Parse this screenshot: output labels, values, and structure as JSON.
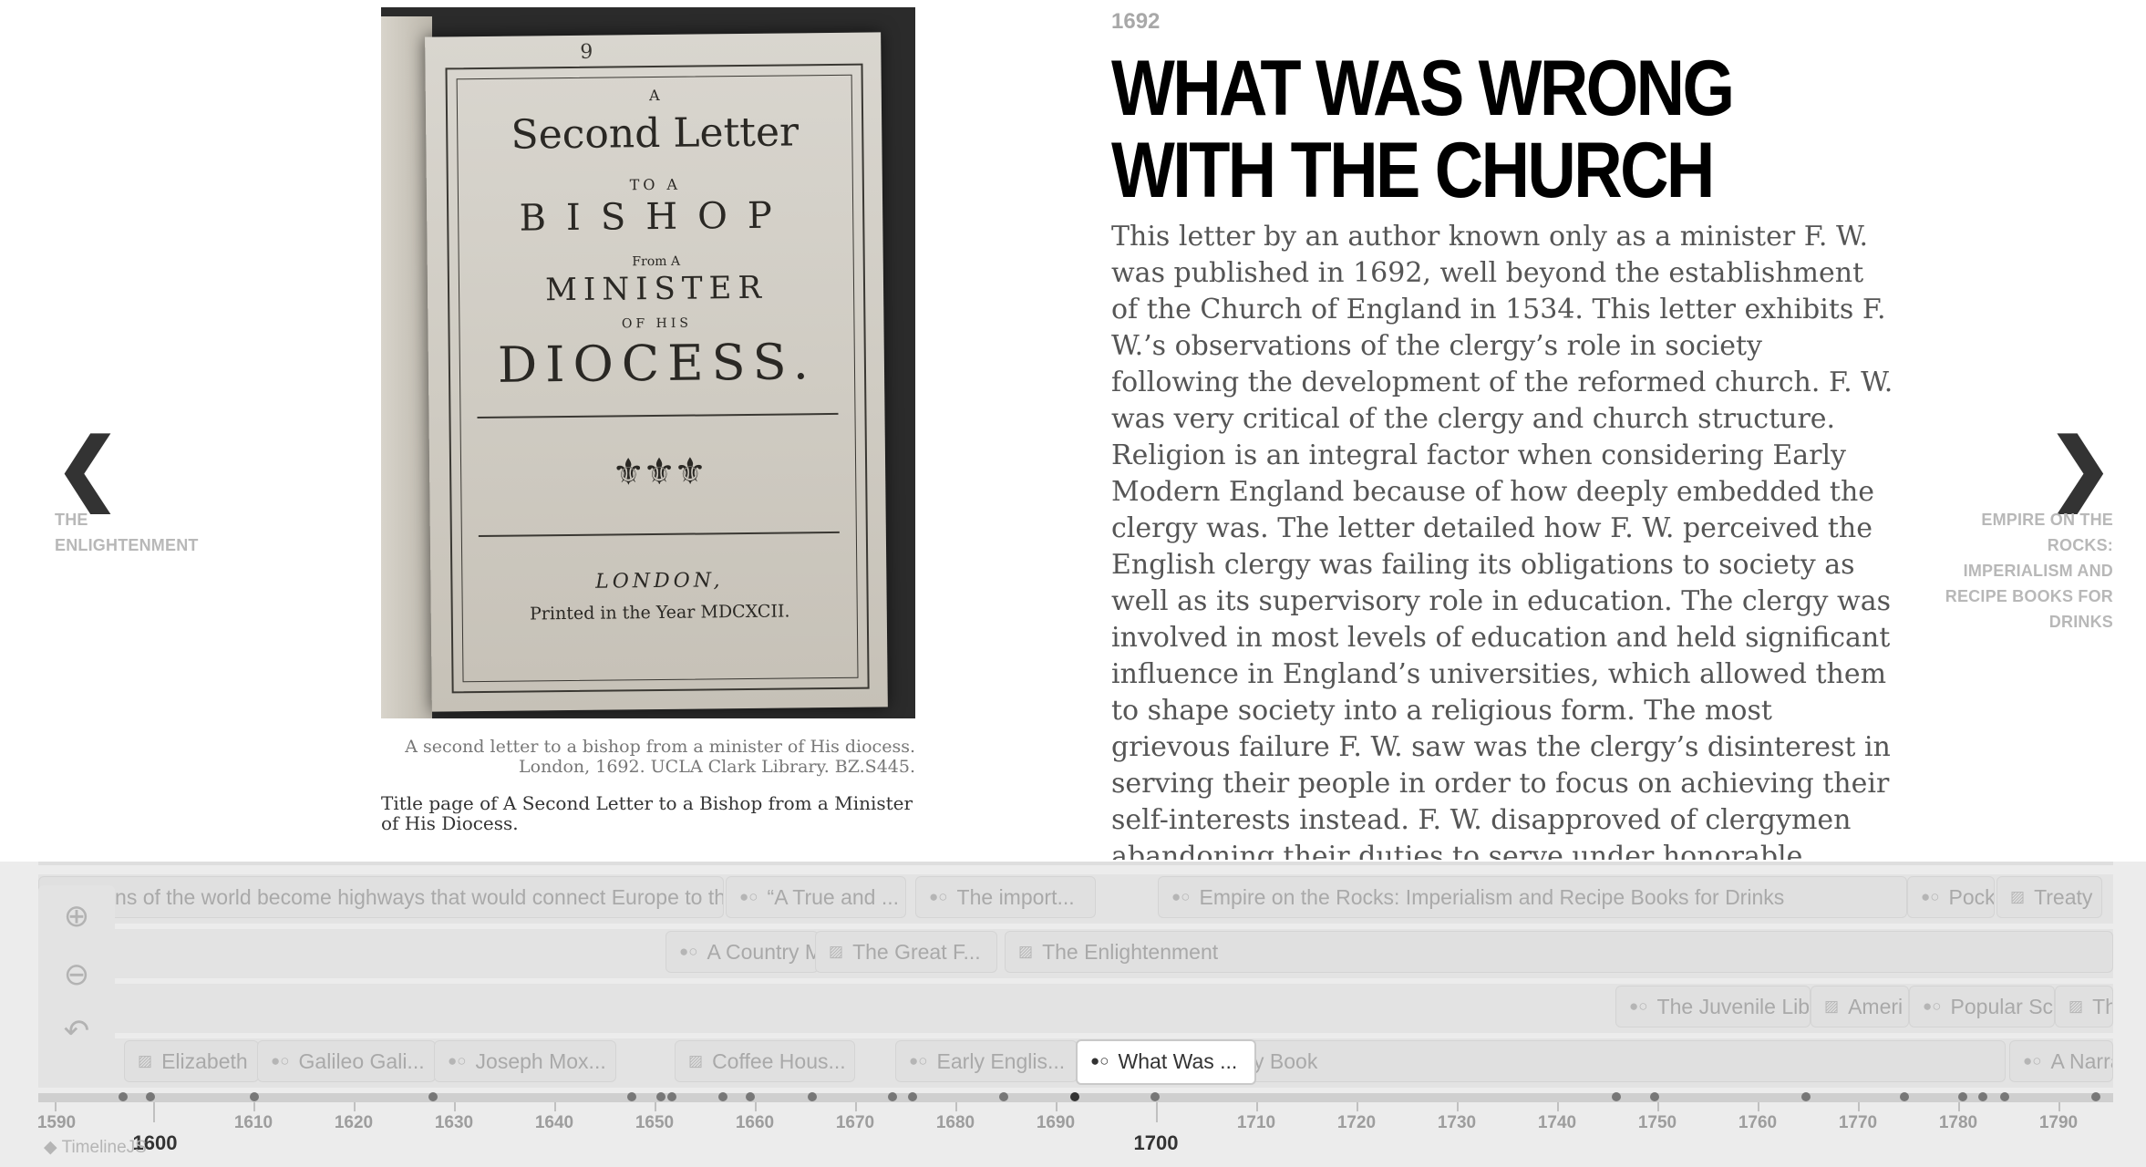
{
  "nav": {
    "prev_label": "THE ENLIGHTENMENT",
    "next_label": "EMPIRE ON THE ROCKS: IMPERIALISM AND RECIPE BOOKS FOR DRINKS",
    "prev_glyph": "❮",
    "next_glyph": "❯"
  },
  "media": {
    "book": {
      "line1": "A",
      "line2": "Second  Letter",
      "line3": "TO A",
      "line4": "BISHOP",
      "line5": "From A",
      "line6": "MINISTER",
      "line7": "OF HIS",
      "line8": "DIOCESS.",
      "line9": "LONDON,",
      "line10": "Printed in the Year MDCXCII.",
      "corner_mark": "9"
    },
    "caption": "A second letter to a bishop from a minister of His diocess. London, 1692. UCLA Clark Library. BZ.S445.",
    "credit": "Title page of A Second Letter to a Bishop from a Minister of His Diocess."
  },
  "slide": {
    "date": "1692",
    "headline": "What Was Wrong with the Church",
    "body": "This letter by an author known only as a minister F. W. was published in 1692, well beyond the establishment of the Church of England in 1534. This letter exhibits F. W.’s observations of the clergy’s role in society following the development of the reformed church. F. W. was very critical of the clergy and church structure. Religion is an integral factor when considering Early Modern England because of how deeply embedded the clergy was. The letter detailed how F. W. perceived the English clergy was failing its obligations to society as well as its supervisory role in education. The clergy was involved in most levels of education and held significant influence in England’s universities, which allowed them to shape society into a religious form. The most grievous failure F. W. saw was the clergy’s disinterest in serving their people in order to focus on achieving their self-interests instead. F. W. disapproved of clergymen abandoning their duties to serve under honorable persons and frequent the royal court in hopes of"
  },
  "timeline": {
    "markers": {
      "r1a": "...oceans of the world become highways that would connect Europe to the re...",
      "r1b": "“A True and ...",
      "r1c": "The import...",
      "r1d": "Empire on the Rocks: Imperialism and Recipe Books for Drinks",
      "r1e": "Pock",
      "r1f": "Treaty",
      "r2a": "A Country M",
      "r2b": "The Great F...",
      "r2c": "The Enlightenment",
      "r3a": "The Juvenile Lib",
      "r3b": "Ameri",
      "r3c": "Popular Sc",
      "r3d": "Th",
      "r4a": "Elizabeth",
      "r4b": "Galileo Gali...",
      "r4c": "Joseph Mox...",
      "r4d": "Coffee Hous...",
      "r4e": "Early Englis...",
      "r4f": "What Was ...",
      "r4g": "y Book",
      "r4h": "A Narra"
    },
    "years": [
      "1590",
      "1610",
      "1620",
      "1630",
      "1640",
      "1650",
      "1660",
      "1670",
      "1680",
      "1690",
      "1710",
      "1720",
      "1730",
      "1740",
      "1750",
      "1760",
      "1770",
      "1780",
      "1790"
    ],
    "major_years": [
      "1600",
      "1700"
    ],
    "brand": "TimelineJS",
    "icons": {
      "zoom_in": "zoom-in-icon",
      "zoom_out": "zoom-out-icon",
      "back": "back-to-start-icon"
    }
  }
}
